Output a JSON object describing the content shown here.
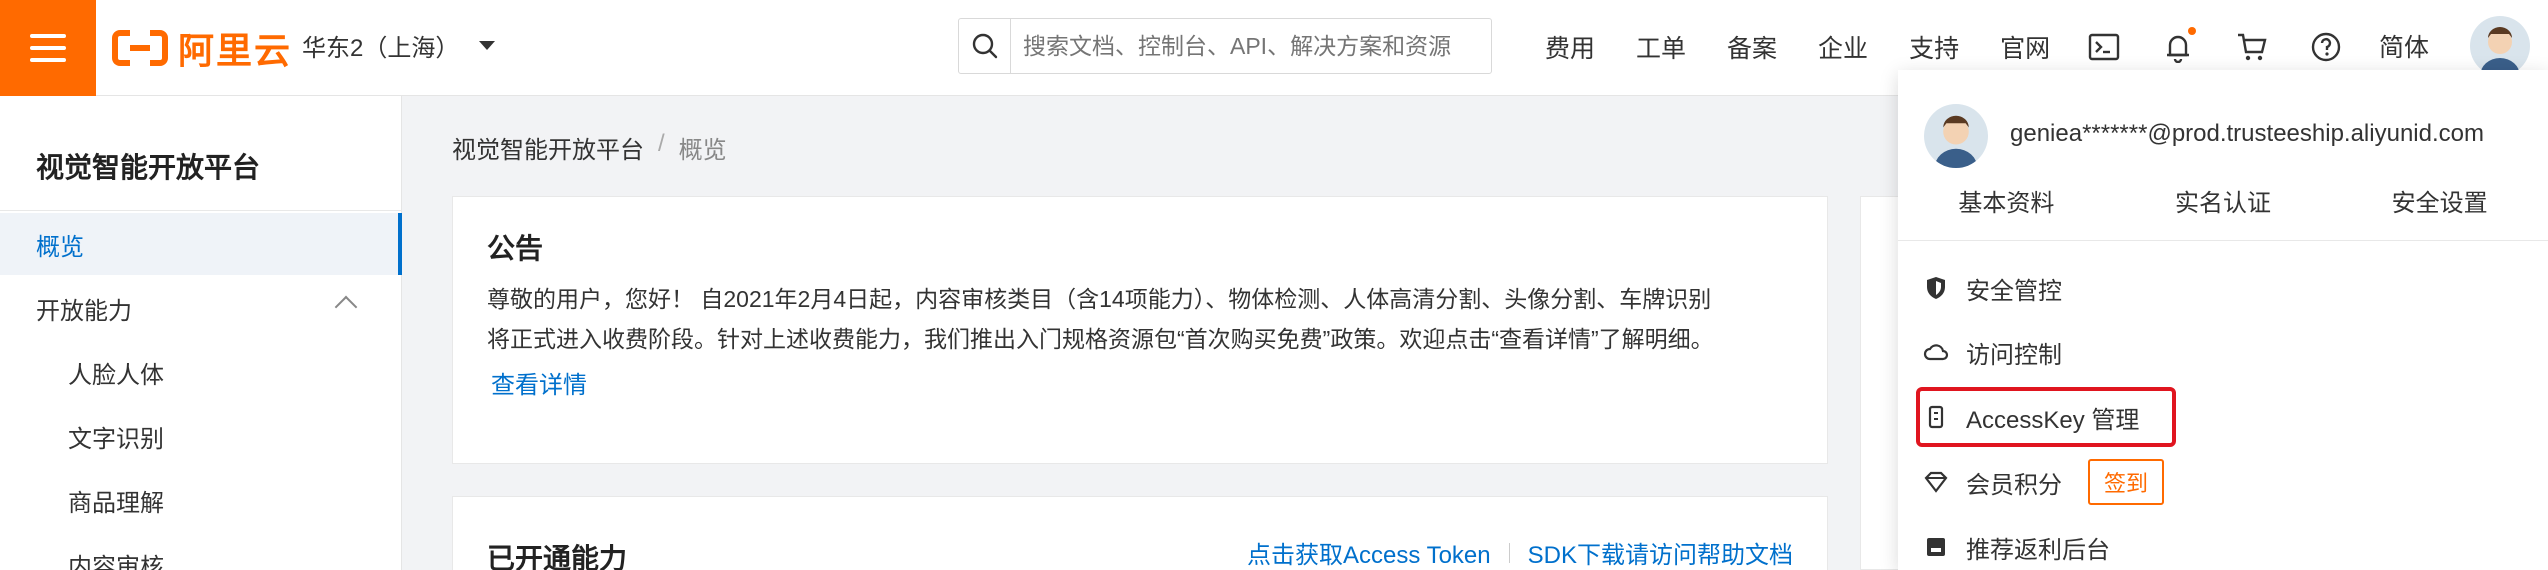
{
  "topbar": {
    "brand": "阿里云",
    "region": "华东2（上海）",
    "search_placeholder": "搜索文档、控制台、API、解决方案和资源",
    "nav": [
      "费用",
      "工单",
      "备案",
      "企业",
      "支持",
      "官网"
    ],
    "lang": "简体"
  },
  "sidebar": {
    "title": "视觉智能开放平台",
    "items": [
      {
        "label": "概览"
      },
      {
        "label": "开放能力"
      },
      {
        "label": "人脸人体"
      },
      {
        "label": "文字识别"
      },
      {
        "label": "商品理解"
      },
      {
        "label": "内容审核"
      }
    ]
  },
  "breadcrumb": {
    "root": "视觉智能开放平台",
    "separator": "/",
    "current": "概览"
  },
  "notice": {
    "title": "公告",
    "line1": "尊敬的用户，您好！ 自2021年2月4日起，内容审核类目（含14项能力）、物体检测、人体高清分割、头像分割、车牌识别",
    "line2": "将正式进入收费阶段。针对上述收费能力，我们推出入门规格资源包“首次购买免费”政策。欢迎点击“查看详情”了解明细。",
    "link": "查看详情"
  },
  "opened": {
    "title": "已开通能力",
    "link1": "点击获取Access Token",
    "link2": "SDK下载请访问帮助文档"
  },
  "account_menu": {
    "email": "geniea*******@prod.trusteeship.aliyunid.com",
    "tabs": [
      "基本资料",
      "实名认证",
      "安全设置"
    ],
    "items": [
      {
        "label": "安全管控",
        "icon": "shield-icon"
      },
      {
        "label": "访问控制",
        "icon": "cloud-icon"
      },
      {
        "label": "AccessKey 管理",
        "icon": "key-icon"
      },
      {
        "label": "会员积分",
        "icon": "diamond-icon",
        "action": "签到"
      },
      {
        "label": "推荐返利后台",
        "icon": "gift-icon"
      }
    ]
  },
  "colors": {
    "brand": "#ff6a00",
    "link": "#0070cc",
    "highlight": "#e0151f"
  }
}
